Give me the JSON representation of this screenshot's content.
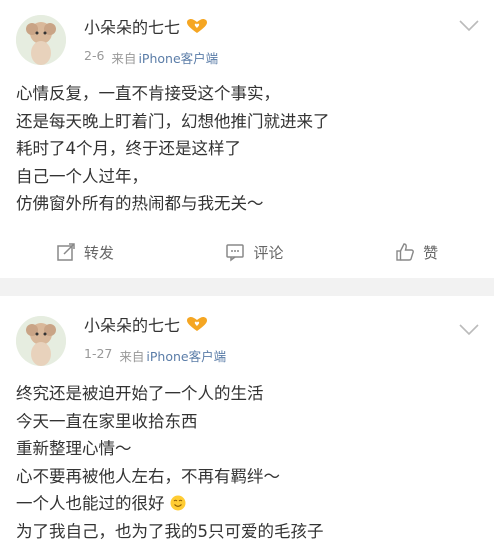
{
  "posts": [
    {
      "username": "小朵朵的七七",
      "date": "2-6",
      "source_prefix": "来自",
      "client": "iPhone客户端",
      "lines": [
        "心情反复，一直不肯接受这个事实，",
        "还是每天晚上盯着门，幻想他推门就进来了",
        "耗时了4个月，终于还是这样了",
        "自己一个人过年，",
        "仿佛窗外所有的热闹都与我无关～"
      ],
      "actions": {
        "repost": "转发",
        "comment": "评论",
        "like": "赞"
      }
    },
    {
      "username": "小朵朵的七七",
      "date": "1-27",
      "source_prefix": "来自",
      "client": "iPhone客户端",
      "lines": [
        "终究还是被迫开始了一个人的生活",
        "今天一直在家里收拾东西",
        "重新整理心情～",
        "心不要再被他人左右，不再有羁绊～",
        "一个人也能过的很好",
        "为了我自己，也为了我的5只可爱的毛孩子"
      ]
    }
  ],
  "colors": {
    "background": "#f2f2f2",
    "card": "#ffffff",
    "text": "#333333",
    "meta": "#999999",
    "client_link": "#5b7da8",
    "vip_badge": "#f5a623"
  },
  "icons": [
    "avatar-dog",
    "vip-icon",
    "chevron-down-icon",
    "repost-icon",
    "comment-icon",
    "like-icon",
    "smile-emoji"
  ]
}
